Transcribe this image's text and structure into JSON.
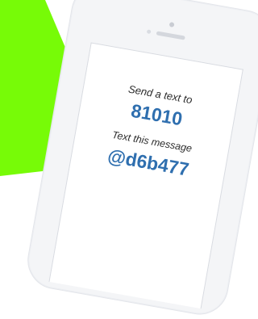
{
  "background_accent": "#77fb07",
  "phone": {
    "send_label": "Send a text to",
    "number": "81010",
    "message_label": "Text this message",
    "code": "@d6b477",
    "text_color": "#2f6faf"
  }
}
